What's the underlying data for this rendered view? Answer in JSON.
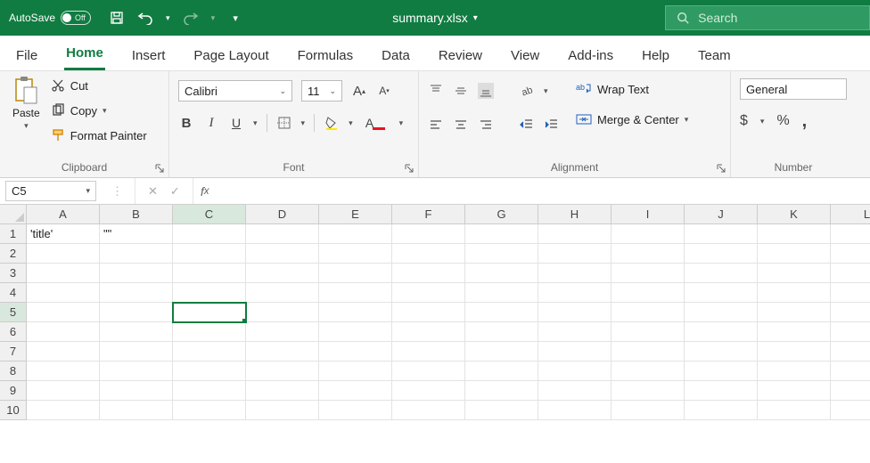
{
  "titlebar": {
    "autosave_label": "AutoSave",
    "autosave_state": "Off",
    "filename": "summary.xlsx",
    "search_placeholder": "Search"
  },
  "tabs": [
    "File",
    "Home",
    "Insert",
    "Page Layout",
    "Formulas",
    "Data",
    "Review",
    "View",
    "Add-ins",
    "Help",
    "Team"
  ],
  "active_tab": "Home",
  "clipboard": {
    "paste": "Paste",
    "cut": "Cut",
    "copy": "Copy",
    "format_painter": "Format Painter",
    "group": "Clipboard"
  },
  "font": {
    "name": "Calibri",
    "size": "11",
    "group": "Font"
  },
  "alignment": {
    "wrap": "Wrap Text",
    "merge": "Merge & Center",
    "group": "Alignment"
  },
  "number": {
    "format": "General",
    "group": "Number"
  },
  "namebox": "C5",
  "formula": "",
  "columns": [
    "A",
    "B",
    "C",
    "D",
    "E",
    "F",
    "G",
    "H",
    "I",
    "J",
    "K",
    "L"
  ],
  "rows": [
    "1",
    "2",
    "3",
    "4",
    "5",
    "6",
    "7",
    "8",
    "9",
    "10"
  ],
  "active_col": "C",
  "active_row": "5",
  "cell_data": {
    "A1": "'title'",
    "B1": "\"\""
  }
}
